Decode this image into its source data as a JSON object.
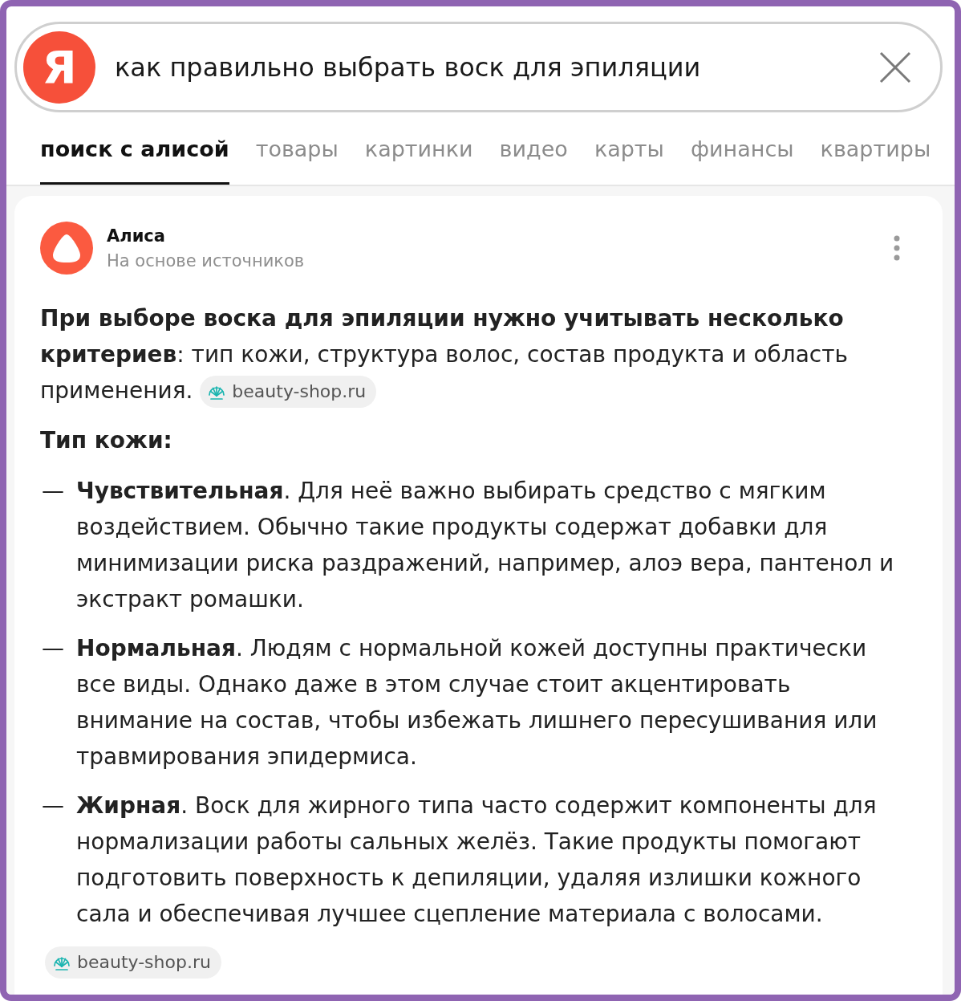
{
  "search": {
    "logo": "Я",
    "query": "как правильно выбрать воск для эпиляции"
  },
  "tabs": [
    {
      "label": "поиск с алисой",
      "selected": true
    },
    {
      "label": "товары",
      "selected": false
    },
    {
      "label": "картинки",
      "selected": false
    },
    {
      "label": "видео",
      "selected": false
    },
    {
      "label": "карты",
      "selected": false
    },
    {
      "label": "финансы",
      "selected": false
    },
    {
      "label": "квартиры",
      "selected": false
    }
  ],
  "answer": {
    "author": "Алиса",
    "subtitle": "На основе источников",
    "intro": {
      "text": "**При выборе воска для эпиляции нужно учитывать несколько критериев**: тип кожи, структура волос, состав продукта и область применения.",
      "source": "beauty-shop.ru"
    },
    "heading": "Тип кожи:",
    "items": [
      {
        "marker": "—",
        "text": "**Чувствительная**. Для неё важно выбирать средство с мягким воздействием. Обычно такие продукты содержат добавки для минимизации риска раздражений, например, алоэ вера, пантенол и экстракт ромашки."
      },
      {
        "marker": "—",
        "text": "**Нормальная**. Людям с нормальной кожей доступны практически все виды. Однако даже в этом случае стоит акцентировать внимание на состав, чтобы избежать лишнего пересушивания или травмирования эпидермиса."
      },
      {
        "marker": "—",
        "text": "**Жирная**. Воск для жирного типа часто содержит компоненты для нормализации работы сальных желёз. Такие продукты помогают подготовить поверхность к депиляции, удаляя излишки кожного сала и обеспечивая лучшее сцепление материала с волосами."
      }
    ],
    "source": "beauty-shop.ru"
  }
}
